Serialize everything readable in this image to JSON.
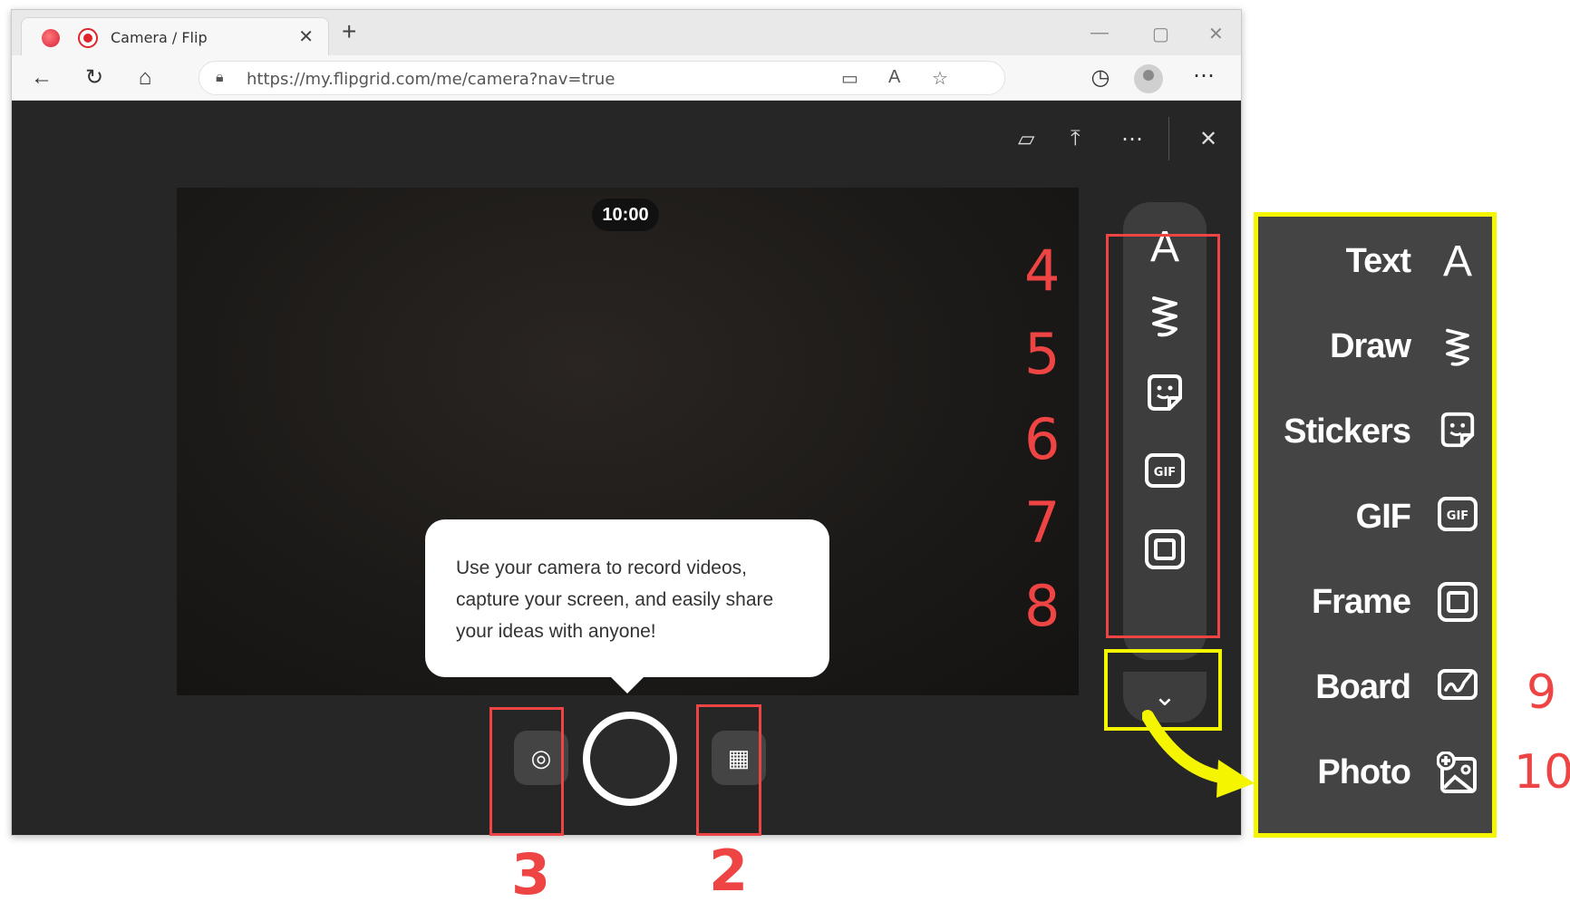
{
  "browser": {
    "tab_title": "Camera / Flip",
    "url": "https://my.flipgrid.com/me/camera?nav=true"
  },
  "camera": {
    "timer": "10:00",
    "tooltip": "Use your camera to record videos, capture your screen, and easily share your ideas with anyone!"
  },
  "rail": [
    {
      "name": "text",
      "icon": "text-icon",
      "glyph": "A"
    },
    {
      "name": "draw",
      "icon": "draw-icon",
      "glyph": "⌇"
    },
    {
      "name": "stickers",
      "icon": "sticker-icon",
      "glyph": ""
    },
    {
      "name": "gif",
      "icon": "gif-icon",
      "glyph": "GIF"
    },
    {
      "name": "frame",
      "icon": "frame-icon",
      "glyph": ""
    }
  ],
  "menu": [
    {
      "label": "Text",
      "icon": "text-icon"
    },
    {
      "label": "Draw",
      "icon": "draw-icon"
    },
    {
      "label": "Stickers",
      "icon": "sticker-icon"
    },
    {
      "label": "GIF",
      "icon": "gif-icon"
    },
    {
      "label": "Frame",
      "icon": "frame-icon"
    },
    {
      "label": "Board",
      "icon": "board-icon"
    },
    {
      "label": "Photo",
      "icon": "photo-icon"
    }
  ],
  "annotations": {
    "n2": "2",
    "n3": "3",
    "n4": "4",
    "n5": "5",
    "n6": "6",
    "n7": "7",
    "n8": "8",
    "n9": "9",
    "n10": "10"
  },
  "colors": {
    "annotation_red": "#ee4444",
    "annotation_yellow": "#f5f500",
    "app_bg": "#262626"
  }
}
